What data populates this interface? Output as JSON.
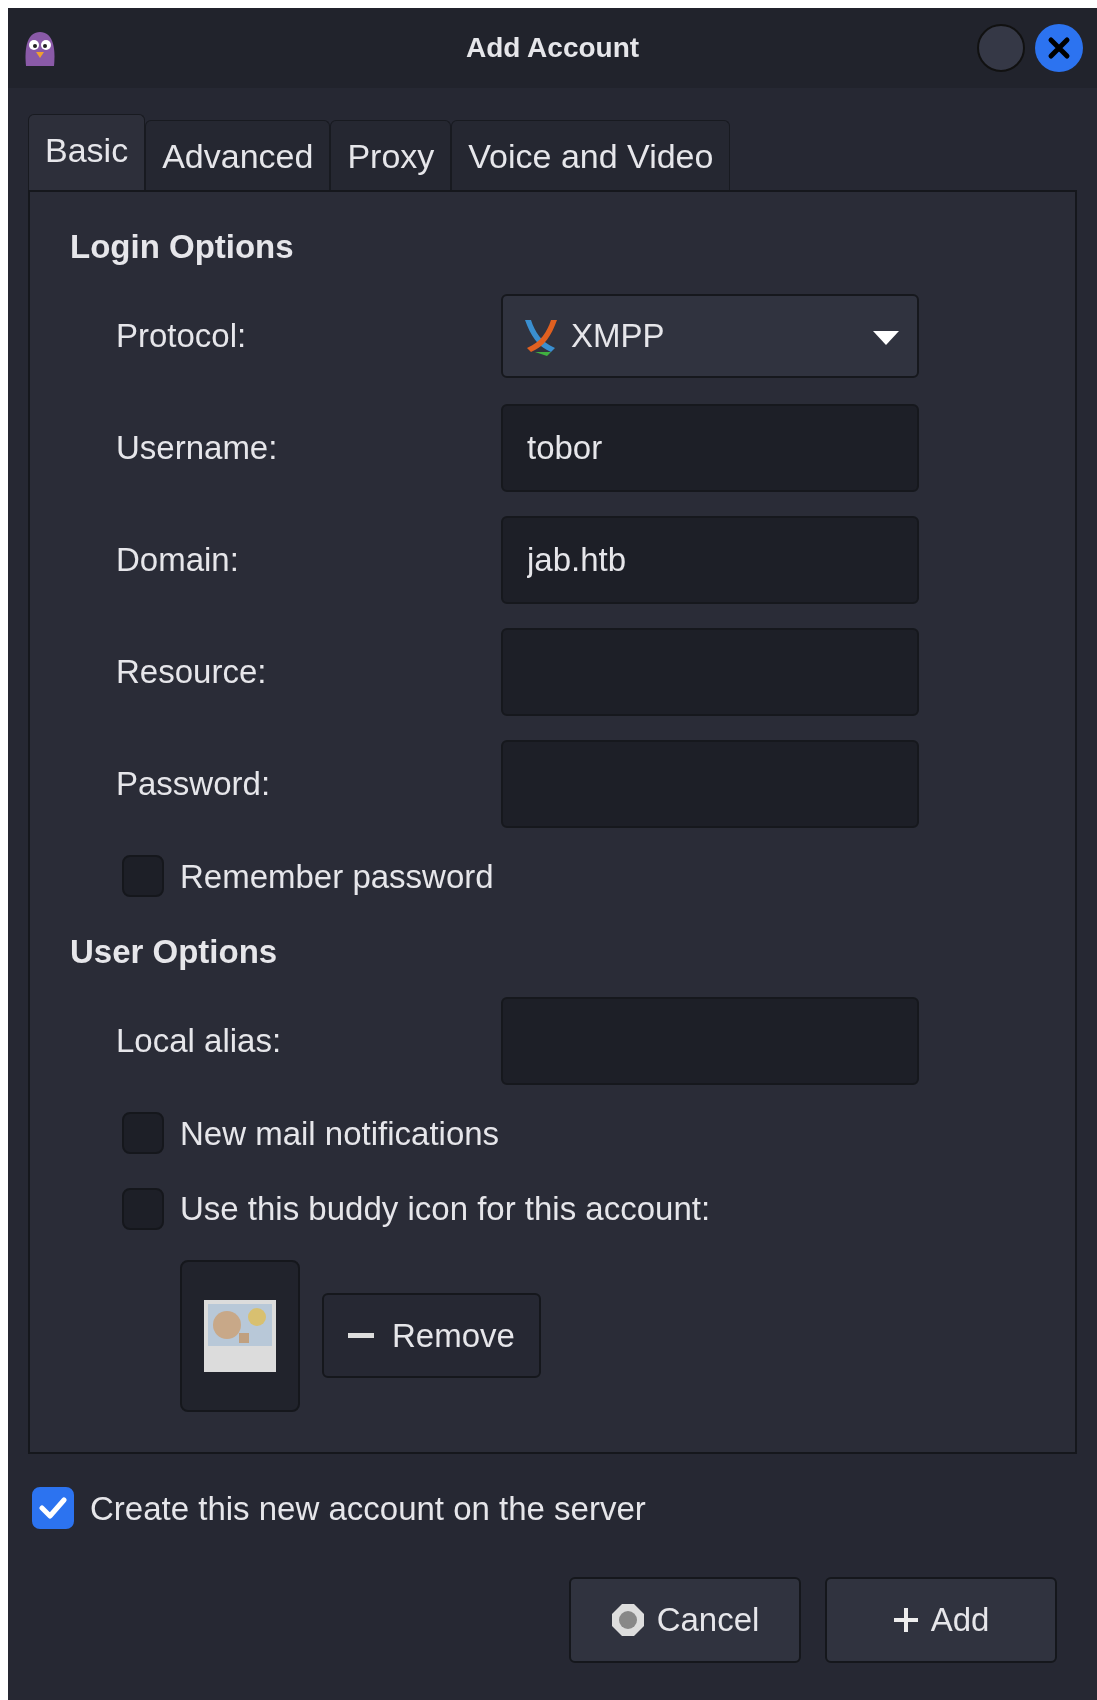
{
  "window": {
    "title": "Add Account"
  },
  "tabs": [
    {
      "label": "Basic",
      "selected": true
    },
    {
      "label": "Advanced",
      "selected": false
    },
    {
      "label": "Proxy",
      "selected": false
    },
    {
      "label": "Voice and Video",
      "selected": false
    }
  ],
  "login_options": {
    "heading": "Login Options",
    "rows": [
      {
        "kind": "combo",
        "label": "Protocol:",
        "value": "XMPP"
      },
      {
        "kind": "entry",
        "label": "Username:",
        "value": "tobor"
      },
      {
        "kind": "entry",
        "label": "Domain:",
        "value": "jab.htb"
      },
      {
        "kind": "entry",
        "label": "Resource:"
      },
      {
        "kind": "entry",
        "label": "Password:"
      },
      {
        "kind": "check",
        "label": "Remember password",
        "checked": false
      }
    ]
  },
  "user_options": {
    "heading": "User Options",
    "rows": [
      {
        "kind": "entry",
        "label": "Local alias:"
      },
      {
        "kind": "check",
        "label": "New mail notifications",
        "checked": false
      },
      {
        "kind": "check",
        "label": "Use this buddy icon for this account:",
        "checked": false
      }
    ],
    "remove_button": "Remove"
  },
  "create_on_server": {
    "label": "Create this new account on the server",
    "checked": true
  },
  "buttons": [
    {
      "kind": "cancel",
      "label": "Cancel"
    },
    {
      "kind": "add",
      "label": "Add"
    }
  ]
}
